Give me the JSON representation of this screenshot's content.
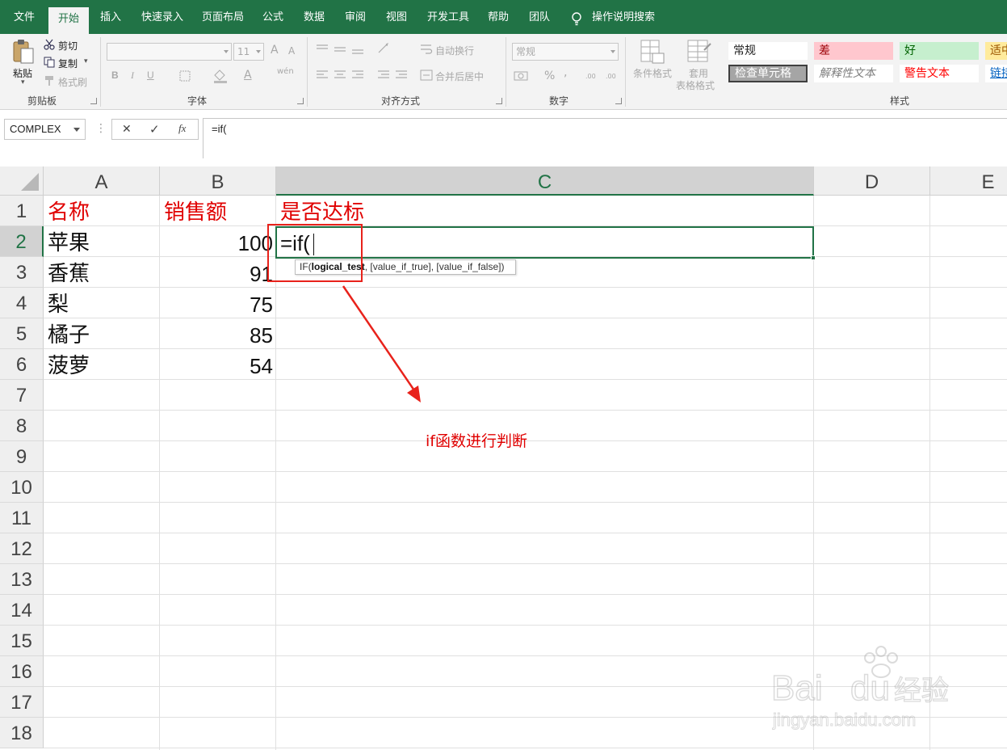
{
  "ribbon_tabs": [
    "文件",
    "开始",
    "插入",
    "快速录入",
    "页面布局",
    "公式",
    "数据",
    "审阅",
    "视图",
    "开发工具",
    "帮助",
    "团队"
  ],
  "active_tab": "开始",
  "tell_me": "操作说明搜索",
  "clipboard": {
    "paste": "粘贴",
    "cut": "剪切",
    "copy": "复制",
    "format_painter": "格式刷",
    "group_label": "剪贴板"
  },
  "font": {
    "size": "11",
    "bold": "B",
    "italic": "I",
    "underline": "U",
    "grow": "A",
    "shrink": "A",
    "color": "A",
    "phonetic": "wén",
    "group_label": "字体"
  },
  "alignment": {
    "wrap": "自动换行",
    "merge": "合并后居中",
    "group_label": "对齐方式"
  },
  "number": {
    "format": "常规",
    "percent": "%",
    "comma": ",",
    "inc_decimal": ".00",
    "dec_decimal": ".00",
    "group_label": "数字"
  },
  "styles": {
    "conditional": "条件格式",
    "table_line1": "套用",
    "table_line2": "表格格式",
    "normal": "常规",
    "bad": "差",
    "good": "好",
    "neutral": "适中",
    "check_cell": "检查单元格",
    "explanatory": "解释性文本",
    "warning": "警告文本",
    "link": "链接",
    "group_label": "样式"
  },
  "colors": {
    "brand_green": "#217346",
    "annotation_red": "#e00000",
    "bad_bg": "#ffc7ce",
    "bad_fg": "#9c0006",
    "good_bg": "#c6efce",
    "good_fg": "#006100",
    "neutral_bg": "#ffeb9c",
    "neutral_fg": "#9c5700",
    "check_bg": "#a5a5a5"
  },
  "formula_bar": {
    "name_box": "COMPLEX",
    "cancel": "✕",
    "enter": "✓",
    "fx": "fx",
    "content": "=if("
  },
  "columns": [
    "A",
    "B",
    "C",
    "D",
    "E"
  ],
  "rows": [
    "1",
    "2",
    "3",
    "4",
    "5",
    "6",
    "7",
    "8",
    "9",
    "10",
    "11",
    "12",
    "13",
    "14",
    "15",
    "16",
    "17",
    "18"
  ],
  "sheet": {
    "headers": {
      "a": "名称",
      "b": "销售额",
      "c": "是否达标"
    },
    "data": [
      {
        "name": "苹果",
        "sales": "100"
      },
      {
        "name": "香蕉",
        "sales": "91"
      },
      {
        "name": "梨",
        "sales": "75"
      },
      {
        "name": "橘子",
        "sales": "85"
      },
      {
        "name": "菠萝",
        "sales": "54"
      }
    ],
    "editing_value": "=if(",
    "tooltip": {
      "fn": "IF(",
      "arg1": "logical_test",
      "rest": ", [value_if_true], [value_if_false])"
    }
  },
  "annotation": "if函数进行判断",
  "watermark": {
    "brand": "Bai du 经验",
    "url": "jingyan.baidu.com"
  }
}
